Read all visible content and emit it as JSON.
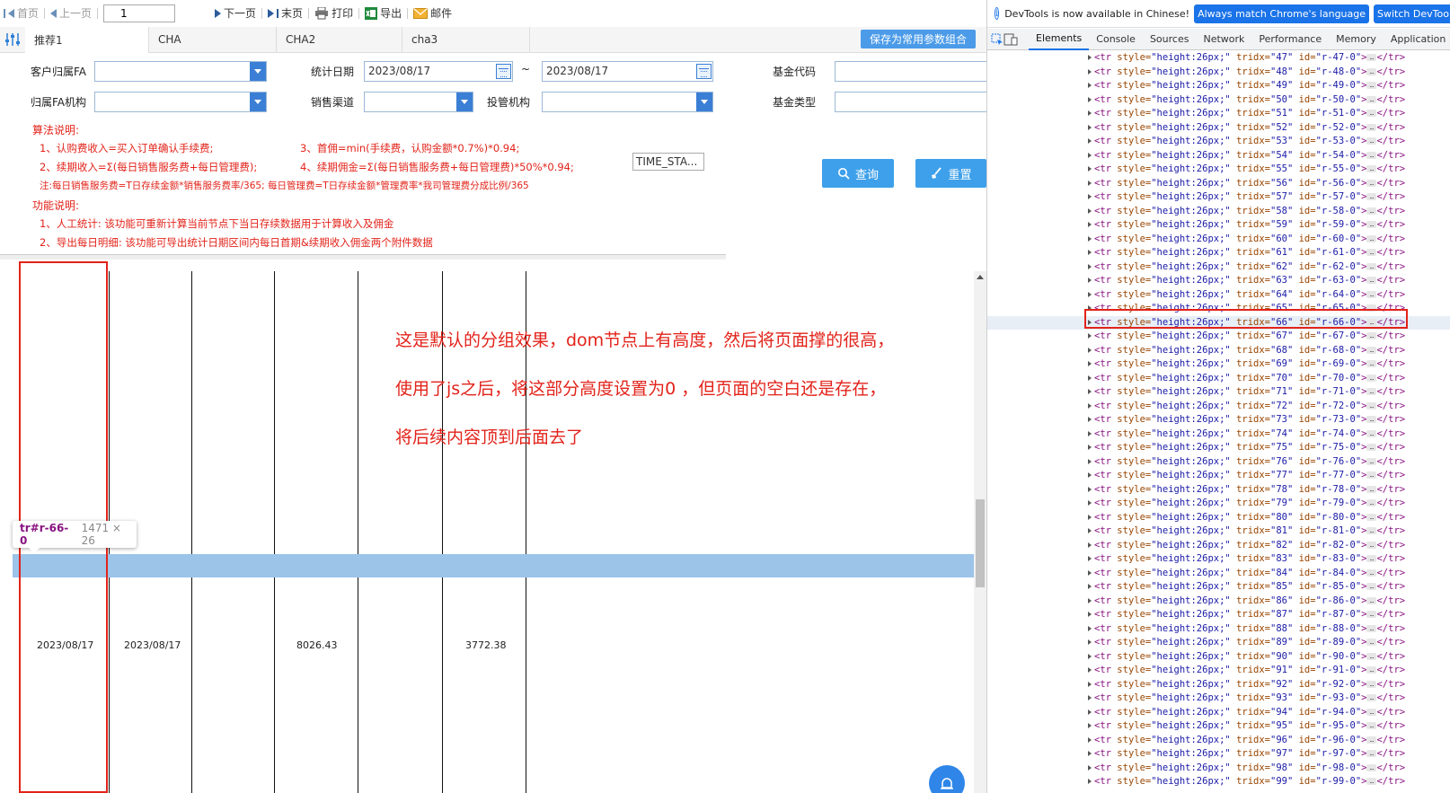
{
  "pager": {
    "first": "首页",
    "prev": "上一页",
    "page_value": "1",
    "next": "下一页",
    "last": "末页",
    "print": "打印",
    "export": "导出",
    "mail": "邮件"
  },
  "tabs": [
    "推荐1",
    "CHA",
    "CHA2",
    "cha3"
  ],
  "save_combo": "保存为常用参数组合",
  "form": {
    "client_fa": "客户归属FA",
    "stat_date": "统计日期",
    "date_from": "2023/08/17",
    "tilde": "~",
    "date_to": "2023/08/17",
    "fund_code": "基金代码",
    "fa_org": "归属FA机构",
    "sales_channel": "销售渠道",
    "invest_org": "投管机构",
    "fund_type": "基金类型"
  },
  "notes": {
    "algo_title": "算法说明:",
    "algo_1": "1、认购费收入=买入订单确认手续费;",
    "algo_3": "3、首佣=min(手续费，认购金额*0.7%)*0.94;",
    "algo_2": "2、续期收入=Σ(每日销售服务费+每日管理费);",
    "algo_4": "4、续期佣金=Σ(每日销售服务费+每日管理费)*50%*0.94;",
    "algo_note": "注:每日销售服务费=T日存续金额*销售服务费率/365; 每日管理费=T日存续金额*管理费率*我司管理费分成比例/365",
    "func_title": "功能说明:",
    "func_1": "1、人工统计: 该功能可重新计算当前节点下当日存续数据用于计算收入及佣金",
    "func_2": "2、导出每日明细: 该功能可导出统计日期区间内每日首期&续期收入佣金两个附件数据"
  },
  "time_box": "TIME_STA...",
  "buttons": {
    "query": "查询",
    "reset": "重置"
  },
  "annotation": [
    "这是默认的分组效果，dom节点上有高度，然后将页面撑的很高，",
    "使用了js之后，将这部分高度设置为0 ，但页面的空白还是存在，",
    "将后续内容顶到后面去了"
  ],
  "tooltip": {
    "selector": "tr#r-66-0",
    "size": "1471 × 26"
  },
  "grid_row": {
    "c1": "2023/08/17",
    "c2": "2023/08/17",
    "c4": "8026.43",
    "c6": "3772.38"
  },
  "devtools": {
    "info_msg": "DevTools is now available in Chinese!",
    "btn_match": "Always match Chrome's language",
    "btn_switch": "Switch DevTools to Chinese",
    "tabs": [
      "Elements",
      "Console",
      "Sources",
      "Network",
      "Performance",
      "Memory",
      "Application"
    ],
    "rows": [
      [
        "47",
        "r-47-0"
      ],
      [
        "48",
        "r-48-0"
      ],
      [
        "49",
        "r-49-0"
      ],
      [
        "50",
        "r-50-0"
      ],
      [
        "51",
        "r-51-0"
      ],
      [
        "52",
        "r-52-0"
      ],
      [
        "53",
        "r-53-0"
      ],
      [
        "54",
        "r-54-0"
      ],
      [
        "55",
        "r-55-0"
      ],
      [
        "56",
        "r-56-0"
      ],
      [
        "57",
        "r-57-0"
      ],
      [
        "58",
        "r-58-0"
      ],
      [
        "59",
        "r-59-0"
      ],
      [
        "60",
        "r-60-0"
      ],
      [
        "61",
        "r-61-0"
      ],
      [
        "62",
        "r-62-0"
      ],
      [
        "63",
        "r-63-0"
      ],
      [
        "64",
        "r-64-0"
      ],
      [
        "65",
        "r-65-0"
      ],
      [
        "66",
        "r-66-0"
      ],
      [
        "67",
        "r-67-0"
      ],
      [
        "68",
        "r-68-0"
      ],
      [
        "69",
        "r-69-0"
      ],
      [
        "70",
        "r-70-0"
      ],
      [
        "71",
        "r-71-0"
      ],
      [
        "72",
        "r-72-0"
      ],
      [
        "73",
        "r-73-0"
      ],
      [
        "74",
        "r-74-0"
      ],
      [
        "75",
        "r-75-0"
      ],
      [
        "76",
        "r-76-0"
      ],
      [
        "77",
        "r-77-0"
      ],
      [
        "78",
        "r-78-0"
      ],
      [
        "79",
        "r-79-0"
      ],
      [
        "80",
        "r-80-0"
      ],
      [
        "81",
        "r-81-0"
      ],
      [
        "82",
        "r-82-0"
      ],
      [
        "83",
        "r-83-0"
      ],
      [
        "84",
        "r-84-0"
      ],
      [
        "85",
        "r-85-0"
      ],
      [
        "86",
        "r-86-0"
      ],
      [
        "87",
        "r-87-0"
      ],
      [
        "88",
        "r-88-0"
      ],
      [
        "89",
        "r-89-0"
      ],
      [
        "90",
        "r-90-0"
      ],
      [
        "91",
        "r-91-0"
      ],
      [
        "92",
        "r-92-0"
      ],
      [
        "93",
        "r-93-0"
      ],
      [
        "94",
        "r-94-0"
      ],
      [
        "95",
        "r-95-0"
      ],
      [
        "96",
        "r-96-0"
      ],
      [
        "97",
        "r-97-0"
      ],
      [
        "98",
        "r-98-0"
      ],
      [
        "99",
        "r-99-0"
      ]
    ],
    "selected_row_id": "r-66-0",
    "tag_style": "height:26px;"
  },
  "colors": {
    "accent": "#3ea0ea",
    "annotation_red": "#e2231a",
    "row_highlight": "#9cc3e8"
  }
}
